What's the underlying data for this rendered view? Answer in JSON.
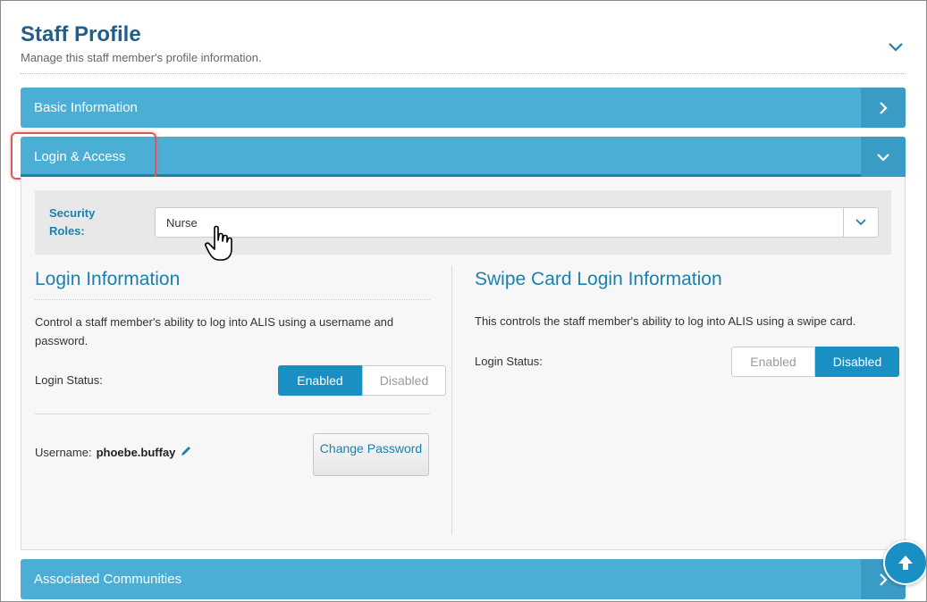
{
  "header": {
    "title": "Staff Profile",
    "subtitle": "Manage this staff member's profile information.",
    "toggle_icon": "chevron-down-icon"
  },
  "panels": {
    "basic": {
      "label": "Basic Information",
      "icon": "chevron-right-icon"
    },
    "login": {
      "label": "Login & Access",
      "icon": "chevron-down-icon"
    },
    "communities": {
      "label": "Associated Communities",
      "icon": "chevron-right-icon"
    }
  },
  "security_roles": {
    "label": "Security Roles:",
    "value": "Nurse"
  },
  "login_info": {
    "title": "Login Information",
    "description": "Control a staff member's ability to log into ALIS using a username and password.",
    "status_label": "Login Status:",
    "enabled_label": "Enabled",
    "disabled_label": "Disabled",
    "selected": "Enabled",
    "username_label": "Username:",
    "username": "phoebe.buffay",
    "change_password": "Change Password"
  },
  "swipe_info": {
    "title": "Swipe Card Login Information",
    "description": "This controls the staff member's ability to log into ALIS using a swipe card.",
    "status_label": "Login Status:",
    "enabled_label": "Enabled",
    "disabled_label": "Disabled",
    "selected": "Disabled"
  },
  "colors": {
    "panel_bar": "#4bafd5",
    "accent": "#1a8fc4",
    "title": "#1f5f8b",
    "highlight": "#e0595a"
  }
}
